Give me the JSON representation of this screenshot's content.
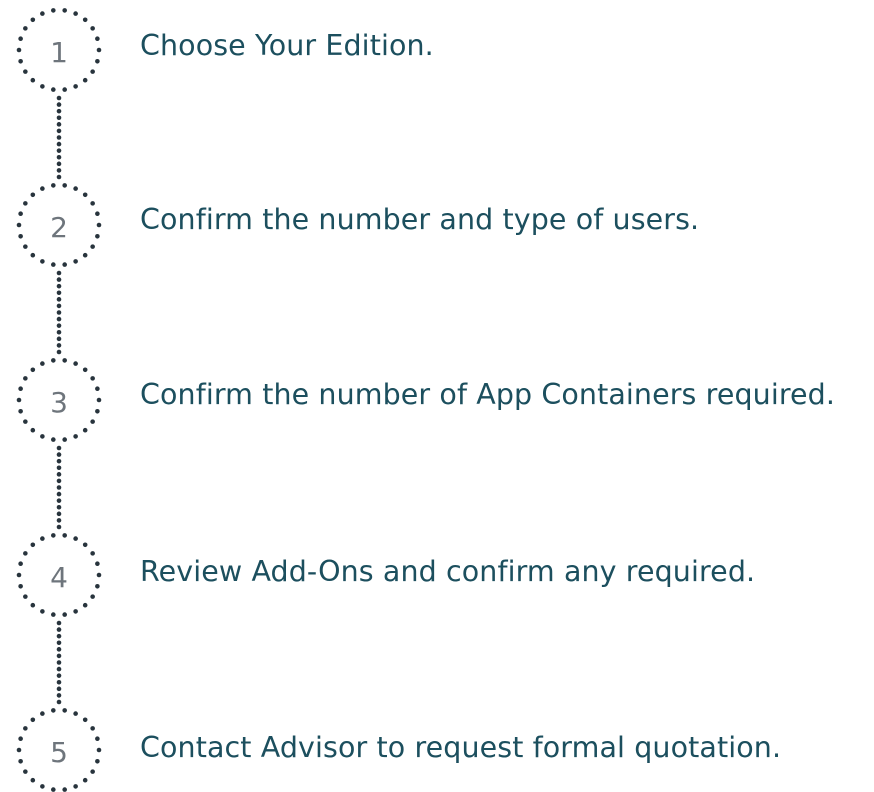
{
  "steps": [
    {
      "number": "1",
      "label": "Choose Your Edition."
    },
    {
      "number": "2",
      "label": "Confirm the number and type of users."
    },
    {
      "number": "3",
      "label": "Confirm the number of App Containers required."
    },
    {
      "number": "4",
      "label": "Review Add-Ons and confirm any required."
    },
    {
      "number": "5",
      "label": "Contact Advisor to request formal quotation."
    }
  ],
  "colors": {
    "label_text": "#1c4f5e",
    "number_text": "#6e757c",
    "dots": "#28343d",
    "background": "#ffffff"
  }
}
